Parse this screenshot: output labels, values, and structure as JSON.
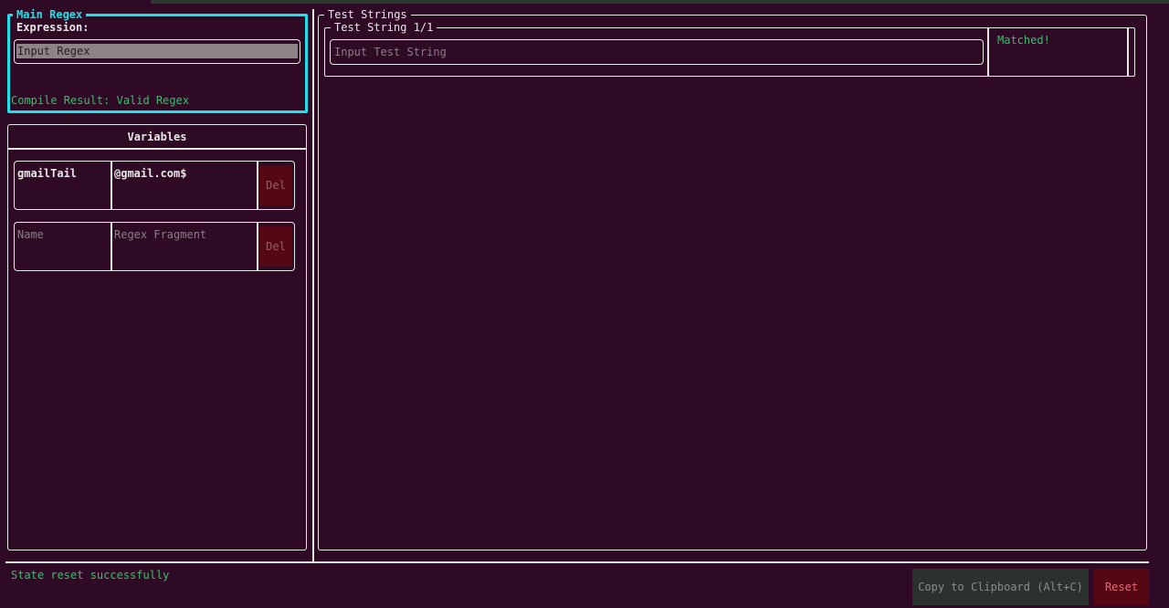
{
  "main_regex": {
    "panel_title": "Main Regex",
    "expression_label": "Expression:",
    "input_placeholder": "Input Regex",
    "compile_result": "Compile Result: Valid Regex"
  },
  "variables": {
    "title": "Variables",
    "rows": [
      {
        "name": "gmailTail",
        "fragment": "@gmail.com$",
        "delete_label": "Del"
      }
    ],
    "new_row": {
      "name_placeholder": "Name",
      "fragment_placeholder": "Regex Fragment",
      "delete_label": "Del"
    }
  },
  "test_strings": {
    "panel_title": "Test Strings",
    "items": [
      {
        "title": "Test String 1/1",
        "placeholder": "Input Test String",
        "result": "Matched!"
      }
    ]
  },
  "status_bar": {
    "message": "State reset successfully",
    "copy_label": "Copy to Clipboard (Alt+C)",
    "reset_label": "Reset"
  },
  "colors": {
    "background": "#2e0a24",
    "focus_border": "#1ee0ea",
    "success_text": "#34c06b",
    "danger_bg": "#560714"
  }
}
